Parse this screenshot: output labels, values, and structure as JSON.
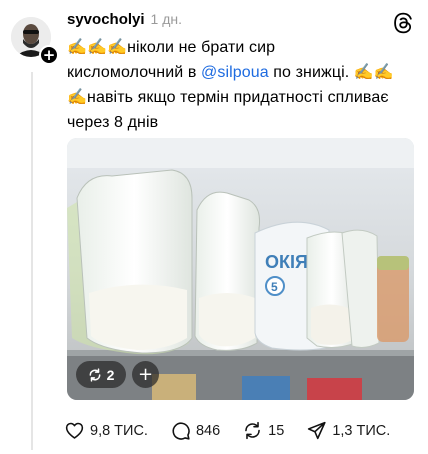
{
  "post": {
    "username": "syvocholyi",
    "time": "1 дн.",
    "text_line1": "✍✍✍ніколи не брати сир",
    "text_line2_a": "кисломолочний в ",
    "mention": "@silpoua",
    "text_line2_b": " по знижці. ✍✍",
    "text_line3": "✍навіть якщо термін придатності спливає",
    "text_line4": "через 8 днів"
  },
  "media": {
    "photo_count": "2",
    "add_symbol": "+",
    "package_label": "ОКІЯ",
    "package_number": "5"
  },
  "actions": {
    "likes": "9,8 ТИС.",
    "comments": "846",
    "reposts": "15",
    "shares": "1,3 ТИС."
  },
  "icons": {
    "follow": "plus-icon",
    "app": "threads-logo",
    "like": "heart-icon",
    "comment": "comment-bubble-icon",
    "repost": "repost-icon",
    "share": "send-icon"
  },
  "colors": {
    "mention": "#1e6be0",
    "muted": "#9a9a9a",
    "text": "#000000"
  }
}
